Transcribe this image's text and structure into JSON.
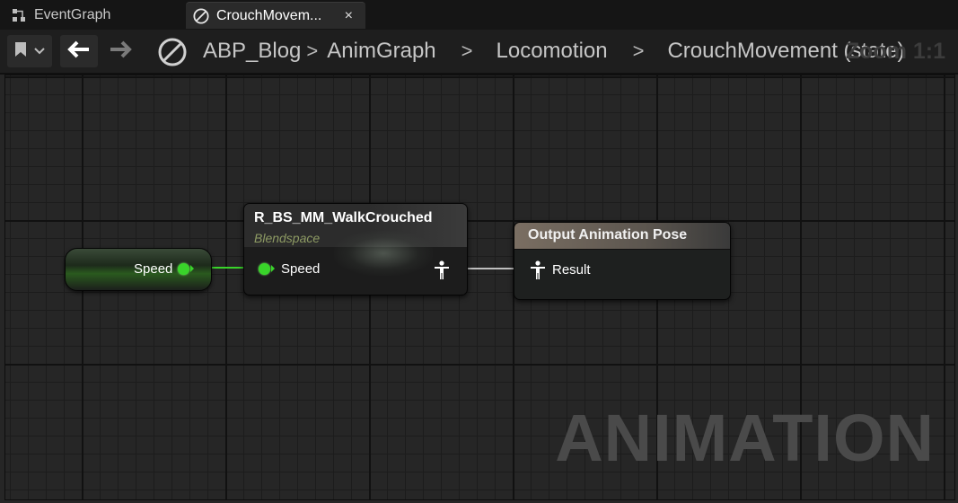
{
  "tabs": [
    {
      "label": "EventGraph",
      "icon": "graph-icon"
    },
    {
      "label": "CrouchMovem...",
      "icon": "state-icon",
      "close": "×"
    }
  ],
  "breadcrumb": {
    "items": [
      "ABP_Blog",
      "AnimGraph",
      "Locomotion",
      "CrouchMovement (state)"
    ],
    "separator": ">"
  },
  "zoom_label": "Zoom 1:1",
  "watermark": "ANIMATION",
  "nodes": {
    "speed_variable": {
      "label": "Speed"
    },
    "blendspace": {
      "title": "R_BS_MM_WalkCrouched",
      "subtitle": "Blendspace",
      "pin_label": "Speed"
    },
    "output_pose": {
      "title": "Output Animation Pose",
      "pin_label": "Result"
    }
  },
  "colors": {
    "float_pin": "#39d42a",
    "pose_wire": "#bfbfbf",
    "subtitle": "#8d9a63"
  }
}
